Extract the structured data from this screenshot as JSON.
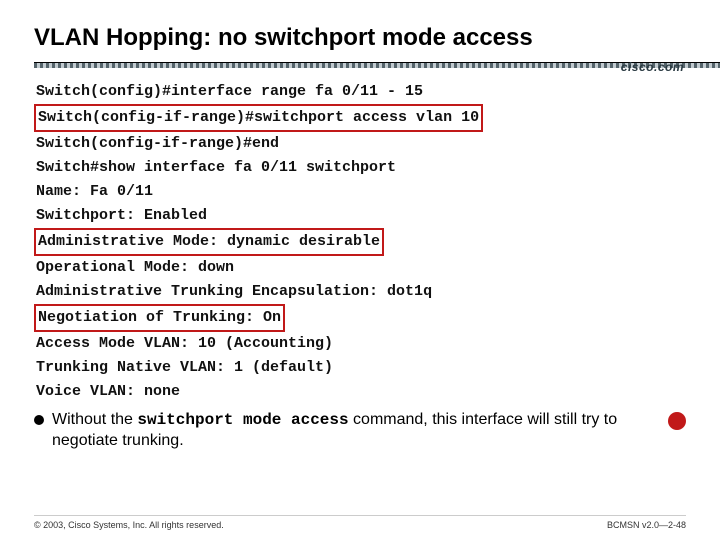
{
  "title": "VLAN Hopping: no switchport mode access",
  "brand": "cisco.com",
  "terminal": {
    "l1": "Switch(config)#interface range fa 0/11 - 15",
    "l2": "Switch(config-if-range)#switchport access vlan 10",
    "l3": "Switch(config-if-range)#end",
    "l4": "",
    "l5": "Switch#show interface fa 0/11 switchport",
    "l6": "Name: Fa 0/11",
    "l7": "Switchport: Enabled",
    "l8": "Administrative Mode: dynamic desirable",
    "l9": "Operational Mode: down",
    "l10": "Administrative Trunking Encapsulation: dot1q",
    "l11": "Negotiation of Trunking: On",
    "l12": "Access Mode VLAN: 10 (Accounting)",
    "l13": "Trunking Native VLAN: 1 (default)",
    "l14": "Voice VLAN: none"
  },
  "bullet": {
    "prefix": "Without the ",
    "keyword": "switchport mode access",
    "suffix": " command, this interface will still try to negotiate trunking."
  },
  "footer": {
    "left": "© 2003, Cisco Systems, Inc. All rights reserved.",
    "right": "BCMSN v2.0—2-48"
  }
}
